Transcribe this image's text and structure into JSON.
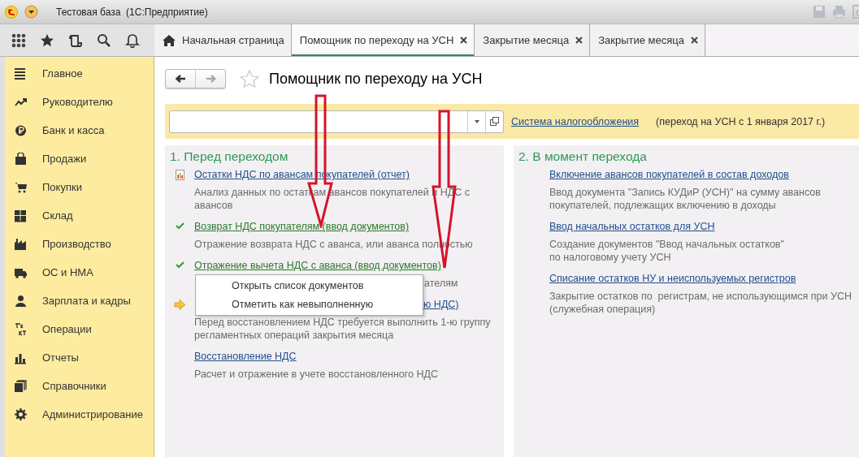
{
  "window": {
    "title": "Тестовая база  (1С:Предприятие)"
  },
  "tabs": [
    {
      "label": "Начальная страница",
      "kind": "home",
      "selected": false
    },
    {
      "label": "Помощник по переходу на УСН",
      "kind": "closable",
      "selected": true
    },
    {
      "label": "Закрытие месяца",
      "kind": "closable",
      "selected": false
    },
    {
      "label": "Закрытие месяца",
      "kind": "closable",
      "selected": false
    }
  ],
  "sidebar": {
    "items": [
      {
        "label": "Главное"
      },
      {
        "label": "Руководителю"
      },
      {
        "label": "Банк и касса"
      },
      {
        "label": "Продажи"
      },
      {
        "label": "Покупки"
      },
      {
        "label": "Склад"
      },
      {
        "label": "Производство"
      },
      {
        "label": "ОС и НМА"
      },
      {
        "label": "Зарплата и кадры"
      },
      {
        "label": "Операции"
      },
      {
        "label": "Отчеты"
      },
      {
        "label": "Справочники"
      },
      {
        "label": "Администрирование"
      }
    ]
  },
  "page": {
    "title": "Помощник по переходу на УСН"
  },
  "tax_bar": {
    "link": "Система налогообложения",
    "note": "(переход на УСН с 1 января 2017 г.)"
  },
  "sections": [
    {
      "heading": "1. Перед переходом",
      "items": [
        {
          "kind": "report",
          "link_cut": false,
          "description_cut": false,
          "link": "Остатки НДС по авансам покупателей (отчет)",
          "description": "Анализ данных по остаткам авансов покупателей и НДС с\nавансов"
        },
        {
          "kind": "done",
          "link_cut": false,
          "description_cut": false,
          "link": "Возврат НДС покупателям (ввод документов)",
          "description": "Отражение возврата НДС с аванса, или аванса полностью"
        },
        {
          "kind": "done",
          "link_cut": false,
          "description_cut": true,
          "link": "Отражение вычета НДС с аванса (ввод документов)",
          "description": "ателям"
        },
        {
          "kind": "current",
          "link_cut": true,
          "description_cut": false,
          "link": "ю НДС)",
          "description": "Перед восстановлением НДС требуется выполнить 1-ю группу\nрегламентных операций закрытия месяца"
        },
        {
          "kind": "plain",
          "link_cut": false,
          "description_cut": false,
          "link": "Восстановление НДС",
          "description": "Расчет и отражение в учете восстановленного НДС"
        }
      ]
    },
    {
      "heading": "2. В момент перехода",
      "items": [
        {
          "kind": "plain",
          "link_cut": false,
          "description_cut": false,
          "link": "Включение авансов покупателей в состав доходов",
          "description": "Ввод документа \"Запись КУДиР (УСН)\" на сумму авансов\nпокупателей, подлежащих включению в доходы"
        },
        {
          "kind": "plain",
          "link_cut": false,
          "description_cut": false,
          "link": "Ввод начальных остатков для УСН",
          "description": "Создание документов \"Ввод начальных остатков\"\nпо налоговому учету УСН"
        },
        {
          "kind": "plain",
          "link_cut": false,
          "description_cut": false,
          "link": "Списание остатков НУ и неиспользуемых регистров",
          "description": "Закрытие остатков по  регистрам, не использующимся при УСН\n(служебная операция)"
        }
      ]
    }
  ],
  "context_menu": {
    "items": [
      "Открыть список документов",
      "Отметить как невыполненную"
    ]
  }
}
